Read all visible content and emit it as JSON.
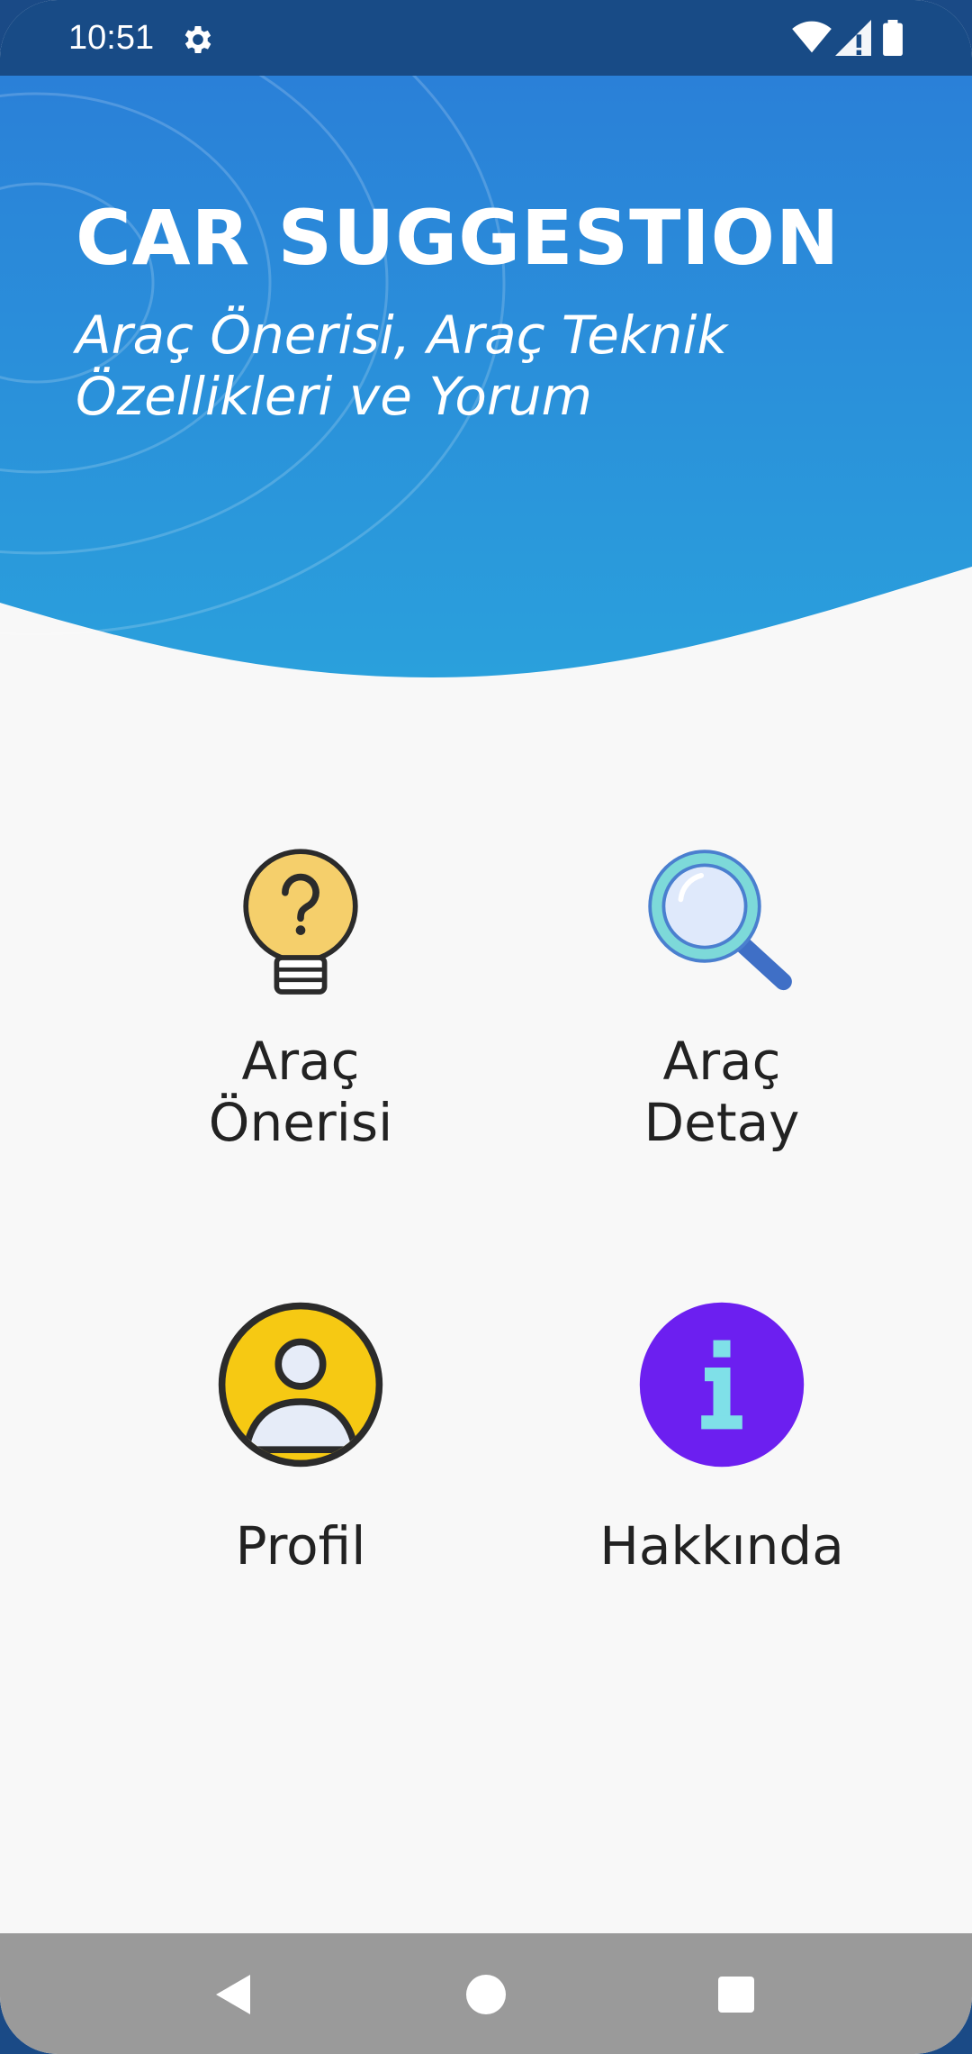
{
  "status_bar": {
    "time": "10:51",
    "icons": [
      "gear-icon",
      "wifi-icon",
      "signal-icon",
      "battery-icon"
    ]
  },
  "header": {
    "title": "CAR SUGGESTION",
    "subtitle": "Araç Önerisi, Araç Teknik Özellikleri ve Yorum",
    "gradient_top": "#2a80d8",
    "gradient_bottom": "#2aa0dc"
  },
  "menu": {
    "items": [
      {
        "id": "arac-onerisi",
        "label": "Araç\nÖnerisi",
        "icon": "lightbulb-question-icon"
      },
      {
        "id": "arac-detay",
        "label": "Araç\nDetay",
        "icon": "magnifier-icon"
      },
      {
        "id": "profil",
        "label": "Profil",
        "icon": "user-profile-icon"
      },
      {
        "id": "hakkinda",
        "label": "Hakkında",
        "icon": "info-icon"
      }
    ]
  },
  "nav_bar": {
    "buttons": [
      "back-icon",
      "home-icon",
      "recents-icon"
    ]
  }
}
